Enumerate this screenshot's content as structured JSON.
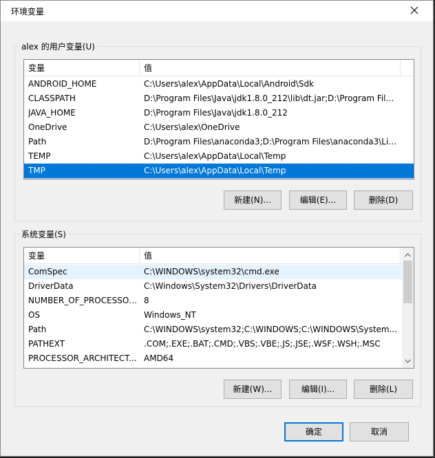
{
  "window": {
    "title": "环境变量",
    "close_icon": "close-icon"
  },
  "user_vars": {
    "group_label": "alex 的用户变量(U)",
    "headers": {
      "name": "变量",
      "value": "值"
    },
    "rows": [
      {
        "name": "ANDROID_HOME",
        "value": "C:\\Users\\alex\\AppData\\Local\\Android\\Sdk"
      },
      {
        "name": "CLASSPATH",
        "value": "D:\\Program Files\\Java\\jdk1.8.0_212\\lib\\dt.jar;D:\\Program Files..."
      },
      {
        "name": "JAVA_HOME",
        "value": "D:\\Program Files\\Java\\jdk1.8.0_212"
      },
      {
        "name": "OneDrive",
        "value": "C:\\Users\\alex\\OneDrive"
      },
      {
        "name": "Path",
        "value": "D:\\Program Files\\anaconda3;D:\\Program Files\\anaconda3\\Lib..."
      },
      {
        "name": "TEMP",
        "value": "C:\\Users\\alex\\AppData\\Local\\Temp"
      },
      {
        "name": "TMP",
        "value": "C:\\Users\\alex\\AppData\\Local\\Temp",
        "selected": true
      }
    ],
    "buttons": {
      "new": "新建(N)...",
      "edit": "编辑(E)...",
      "delete": "删除(D)"
    }
  },
  "system_vars": {
    "group_label": "系统变量(S)",
    "headers": {
      "name": "变量",
      "value": "值"
    },
    "rows": [
      {
        "name": "ComSpec",
        "value": "C:\\WINDOWS\\system32\\cmd.exe",
        "hover": true
      },
      {
        "name": "DriverData",
        "value": "C:\\Windows\\System32\\Drivers\\DriverData"
      },
      {
        "name": "NUMBER_OF_PROCESSORS",
        "value": "8"
      },
      {
        "name": "OS",
        "value": "Windows_NT"
      },
      {
        "name": "Path",
        "value": "C:\\WINDOWS\\system32;C:\\WINDOWS;C:\\WINDOWS\\System..."
      },
      {
        "name": "PATHEXT",
        "value": ".COM;.EXE;.BAT;.CMD;.VBS;.VBE;.JS;.JSE;.WSF;.WSH;.MSC"
      },
      {
        "name": "PROCESSOR_ARCHITECT...",
        "value": "AMD64"
      }
    ],
    "buttons": {
      "new": "新建(W)...",
      "edit": "编辑(I)...",
      "delete": "删除(L)"
    }
  },
  "footer": {
    "ok": "确定",
    "cancel": "取消"
  },
  "colors": {
    "selection": "#0078d7",
    "hover": "#e5f3ff",
    "dialog_bg": "#f0f0f0"
  }
}
